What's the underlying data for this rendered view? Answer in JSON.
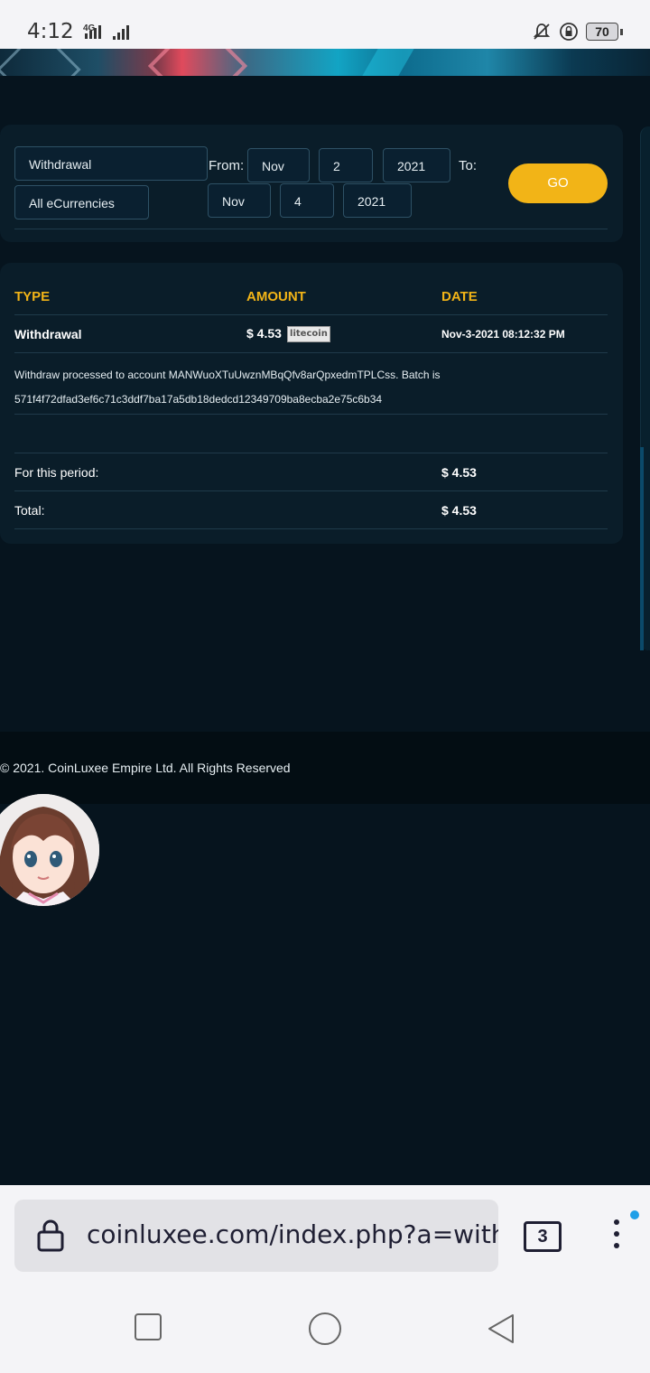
{
  "status": {
    "time": "4:12",
    "network": "4G",
    "battery": "70"
  },
  "filter": {
    "type_value": "Withdrawal",
    "currency_value": "All eCurrencies",
    "from_label": "From:",
    "to_label": "To:",
    "from": {
      "month": "Nov",
      "day": "2",
      "year": "2021"
    },
    "to": {
      "month": "Nov",
      "day": "4",
      "year": "2021"
    },
    "go_label": "GO"
  },
  "table": {
    "headers": {
      "type": "TYPE",
      "amount": "AMOUNT",
      "date": "DATE"
    },
    "rows": [
      {
        "type": "Withdrawal",
        "amount": "$ 4.53",
        "currency_badge": "litecoin",
        "date": "Nov-3-2021 08:12:32 PM"
      }
    ],
    "note_line1": "Withdraw processed to account MANWuoXTuUwznMBqQfv8arQpxedmTPLCss. Batch is",
    "note_line2": "571f4f72dfad3ef6c71c3ddf7ba17a5db18dedcd12349709ba8ecba2e75c6b34",
    "period_label": "For this period:",
    "period_value": "$ 4.53",
    "total_label": "Total:",
    "total_value": "$ 4.53"
  },
  "footer": {
    "copyright": "© 2021. CoinLuxee Empire Ltd. All Rights Reserved"
  },
  "browser": {
    "url": "coinluxee.com/index.php?a=withd",
    "tab_count": "3"
  },
  "colors": {
    "accent": "#f2b417",
    "background": "#06141e",
    "card": "#0a1d29"
  }
}
